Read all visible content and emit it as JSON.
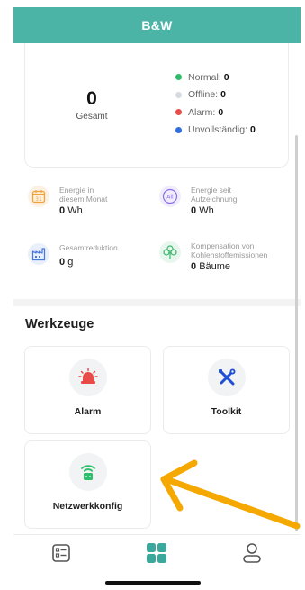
{
  "header": {
    "title": "B&W"
  },
  "summary": {
    "total_value": "0",
    "total_label": "Gesamt",
    "statuses": [
      {
        "label": "Normal:",
        "value": "0",
        "color": "#2ebd6b"
      },
      {
        "label": "Offline:",
        "value": "0",
        "color": "#d6dbe2"
      },
      {
        "label": "Alarm:",
        "value": "0",
        "color": "#e94b48"
      },
      {
        "label": "Unvollständig:",
        "value": "0",
        "color": "#2f6fe0"
      }
    ]
  },
  "stats": {
    "energy_month": {
      "label_line1": "Energie in",
      "label_line2": "diesem Monat",
      "value": "0",
      "unit": "Wh",
      "icon_text": "31",
      "color": "#f0a23c"
    },
    "energy_total": {
      "label_line1": "Energie seit",
      "label_line2": "Aufzeichnung",
      "value": "0",
      "unit": "Wh",
      "icon_text": "All",
      "color": "#8a6de9"
    },
    "reduction": {
      "label_line1": "Gesamtreduktion",
      "value": "0",
      "unit": "g",
      "color": "#4a78d8"
    },
    "carbon": {
      "label_line1": "Kompensation von",
      "label_line2": "Kohlenstoffemissionen",
      "value": "0",
      "unit": "Bäume",
      "color": "#3bb86a"
    }
  },
  "tools": {
    "title": "Werkzeuge",
    "items": [
      {
        "label": "Alarm",
        "icon": "siren-icon",
        "color": "#e94b48"
      },
      {
        "label": "Toolkit",
        "icon": "tools-icon",
        "color": "#1f4fd6"
      },
      {
        "label": "Netzwerkkonfig",
        "icon": "router-icon",
        "color": "#2ebd6b"
      }
    ]
  },
  "tabbar": {
    "items": [
      {
        "icon": "list-icon"
      },
      {
        "icon": "grid-icon",
        "active": true,
        "color": "#3aa89b"
      },
      {
        "icon": "user-icon"
      }
    ]
  },
  "annotation": {
    "arrow_color": "#f5a800"
  }
}
